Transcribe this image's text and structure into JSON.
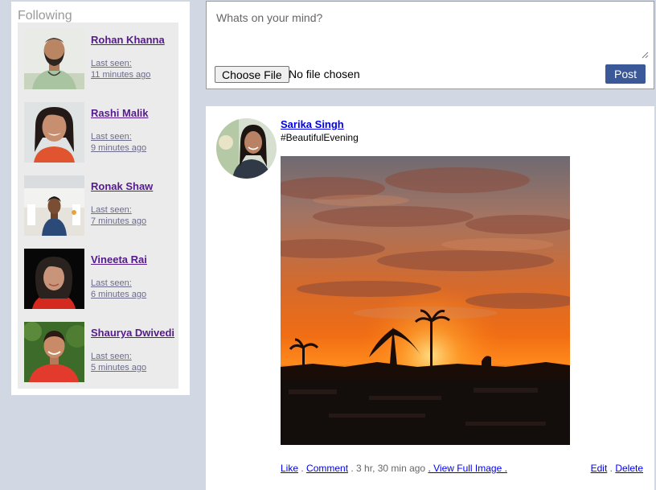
{
  "sidebar": {
    "title": "Following",
    "friends": [
      {
        "name": "Rohan Khanna",
        "last_seen_label": "Last seen:",
        "last_seen": "11 minutes ago"
      },
      {
        "name": "Rashi Malik",
        "last_seen_label": "Last seen:",
        "last_seen": "9 minutes ago"
      },
      {
        "name": "Ronak Shaw",
        "last_seen_label": "Last seen:",
        "last_seen": "7 minutes ago"
      },
      {
        "name": "Vineeta Rai",
        "last_seen_label": "Last seen:",
        "last_seen": "6 minutes ago"
      },
      {
        "name": "Shaurya Dwivedi",
        "last_seen_label": "Last seen:",
        "last_seen": "5 minutes ago"
      }
    ]
  },
  "composer": {
    "placeholder": "Whats on your mind?",
    "file_button": "Choose File",
    "file_status": "No file chosen",
    "post_button": "Post"
  },
  "post": {
    "author": "Sarika Singh",
    "caption": "#BeautifulEvening",
    "actions": {
      "like": "Like",
      "sep1": " . ",
      "comment": "Comment",
      "time": " . 3 hr, 30 min ago ",
      "view_full": ". View Full Image .",
      "edit": "Edit",
      "sep2": " . ",
      "delete": "Delete"
    }
  },
  "colors": {
    "page_bg": "#d1d8e4",
    "post_button": "#3b5998",
    "friend_link": "#551a8b",
    "author_link": "#0000ee",
    "sidebar_list_bg": "#ebebeb"
  }
}
